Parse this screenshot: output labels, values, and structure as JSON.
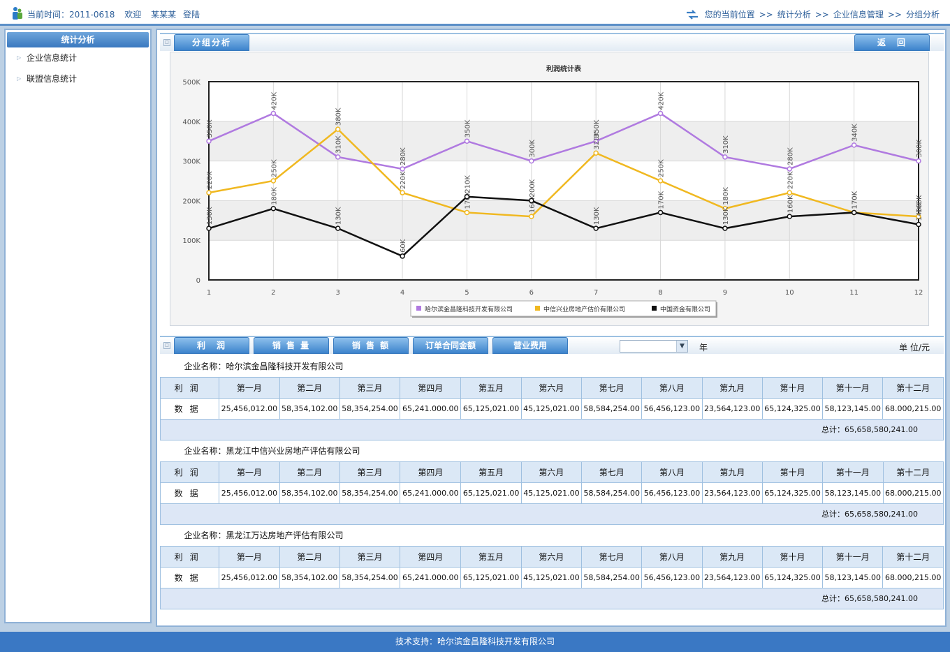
{
  "header": {
    "time_label": "当前时间：2011-0618",
    "welcome": "欢迎",
    "user": "某某某",
    "login": "登陆",
    "location_label": "您的当前位置",
    "breadcrumb": [
      "统计分析",
      "企业信息管理",
      "分组分析"
    ],
    "breadcrumb_sep": ">>"
  },
  "sidebar": {
    "title": "统计分析",
    "items": [
      {
        "label": "企业信息统计"
      },
      {
        "label": "联盟信息统计"
      }
    ]
  },
  "panel": {
    "tab_label": "分组分析",
    "back_label": "返　回"
  },
  "chart_data": {
    "type": "line",
    "title": "利润统计表",
    "x": [
      1,
      2,
      3,
      4,
      5,
      6,
      7,
      8,
      9,
      10,
      11,
      12
    ],
    "ylim": [
      0,
      500000
    ],
    "yticks": [
      "0",
      "100K",
      "200K",
      "300K",
      "400K",
      "500K"
    ],
    "grid": true,
    "legend_position": "bottom",
    "series": [
      {
        "name": "哈尔滨金昌隆科技开发有限公司",
        "color": "#b07ae0",
        "values": [
          350000,
          420000,
          310000,
          280000,
          350000,
          300000,
          350000,
          420000,
          310000,
          280000,
          340000,
          300000
        ]
      },
      {
        "name": "中信兴业房地产估价有限公司",
        "color": "#f0b820",
        "values": [
          220000,
          250000,
          380000,
          220000,
          170000,
          160000,
          320000,
          250000,
          180000,
          220000,
          170000,
          160000
        ]
      },
      {
        "name": "中国资金有限公司",
        "color": "#111111",
        "values": [
          130000,
          180000,
          130000,
          60000,
          210000,
          200000,
          130000,
          170000,
          130000,
          160000,
          170000,
          140000
        ]
      }
    ]
  },
  "toolbar": {
    "tabs": [
      "利　润",
      "销 售 量",
      "销 售 额",
      "订单合同金额",
      "营业费用"
    ],
    "select_value": "",
    "year_label": "年",
    "unit_label": "单 位/元"
  },
  "tables": [
    {
      "company": "企业名称：哈尔滨金昌隆科技开发有限公司",
      "row_label": "利润",
      "data_label": "数据",
      "months": [
        "第一月",
        "第二月",
        "第三月",
        "第四月",
        "第五月",
        "第六月",
        "第七月",
        "第八月",
        "第九月",
        "第十月",
        "第十一月",
        "第十二月"
      ],
      "values": [
        "25,456,012.00",
        "58,354,102.00",
        "58,354,254.00",
        "65,241.000.00",
        "65,125,021.00",
        "45,125,021.00",
        "58,584,254.00",
        "56,456,123.00",
        "23,564,123.00",
        "65,124,325.00",
        "58,123,145.00",
        "68.000,215.00"
      ],
      "total": "总计：65,658,580,241.00"
    },
    {
      "company": "企业名称：黑龙江中信兴业房地产评估有限公司",
      "row_label": "利润",
      "data_label": "数据",
      "months": [
        "第一月",
        "第二月",
        "第三月",
        "第四月",
        "第五月",
        "第六月",
        "第七月",
        "第八月",
        "第九月",
        "第十月",
        "第十一月",
        "第十二月"
      ],
      "values": [
        "25,456,012.00",
        "58,354,102.00",
        "58,354,254.00",
        "65,241.000.00",
        "65,125,021.00",
        "45,125,021.00",
        "58,584,254.00",
        "56,456,123.00",
        "23,564,123.00",
        "65,124,325.00",
        "58,123,145.00",
        "68.000,215.00"
      ],
      "total": "总计：65,658,580,241.00"
    },
    {
      "company": "企业名称：黑龙江万达房地产评估有限公司",
      "row_label": "利润",
      "data_label": "数据",
      "months": [
        "第一月",
        "第二月",
        "第三月",
        "第四月",
        "第五月",
        "第六月",
        "第七月",
        "第八月",
        "第九月",
        "第十月",
        "第十一月",
        "第十二月"
      ],
      "values": [
        "25,456,012.00",
        "58,354,102.00",
        "58,354,254.00",
        "65,241.000.00",
        "65,125,021.00",
        "45,125,021.00",
        "58,584,254.00",
        "56,456,123.00",
        "23,564,123.00",
        "65,124,325.00",
        "58,123,145.00",
        "68.000,215.00"
      ],
      "total": "总计：65,658,580,241.00"
    }
  ],
  "footer": {
    "text": "技术支持：哈尔滨金昌隆科技开发有限公司"
  }
}
